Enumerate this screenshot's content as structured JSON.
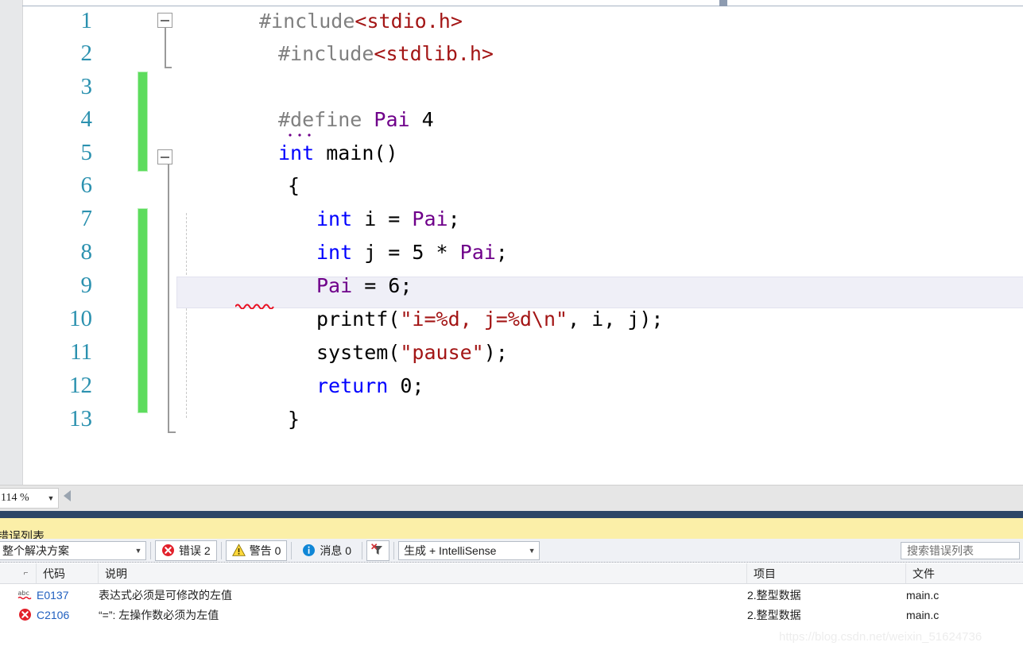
{
  "editor": {
    "zoom_level": "114 %",
    "lines": [
      {
        "num": "1",
        "text": "#include<stdio.h>"
      },
      {
        "num": "2",
        "text": "#include<stdlib.h>"
      },
      {
        "num": "3",
        "text": ""
      },
      {
        "num": "4",
        "text": "#define Pai 4"
      },
      {
        "num": "5",
        "text": "int main()"
      },
      {
        "num": "6",
        "text": "{"
      },
      {
        "num": "7",
        "text": "int i = Pai;"
      },
      {
        "num": "8",
        "text": "int j = 5 * Pai;"
      },
      {
        "num": "9",
        "text": "Pai = 6;"
      },
      {
        "num": "10",
        "text": "printf(\"i=%d, j=%d\\n\", i, j);"
      },
      {
        "num": "11",
        "text": "system(\"pause\");"
      },
      {
        "num": "12",
        "text": "return 0;"
      },
      {
        "num": "13",
        "text": "}"
      }
    ],
    "tokens": {
      "l1_pp": "#include",
      "l1_hdr": "<stdio.h>",
      "l2_pp": "#include",
      "l2_hdr": "<stdlib.h>",
      "l4_pp": "#define ",
      "l4_macro": "Pai",
      "l4_val": " 4",
      "l5_kw": "int",
      "l5_name": " main()",
      "l6": "{",
      "l7_kw": "int",
      "l7_mid": " i = ",
      "l7_macro": "Pai",
      "l7_end": ";",
      "l8_kw": "int",
      "l8_mid": " j = ",
      "l8_num": "5",
      "l8_op": " * ",
      "l8_macro": "Pai",
      "l8_end": ";",
      "l9_macro": "Pai",
      "l9_rest": " = 6;",
      "l10_fn": "printf(",
      "l10_str": "\"i=%d, j=%d\\n\"",
      "l10_args": ", i, j);",
      "l11_fn": "system(",
      "l11_str": "\"pause\"",
      "l11_end": ");",
      "l12_kw": "return",
      "l12_rest": " 0;",
      "l13": "}"
    }
  },
  "error_list": {
    "title": "错误列表",
    "scope_filter": "整个解决方案",
    "errors_label": "错误 2",
    "warnings_label": "警告 0",
    "messages_label": "消息 0",
    "build_filter": "生成 + IntelliSense",
    "search_placeholder": "搜索错误列表",
    "columns": [
      "",
      "代码",
      "说明",
      "项目",
      "文件"
    ],
    "rows": [
      {
        "icon": "intellisense-abc-icon",
        "code": "E0137",
        "description": "表达式必须是可修改的左值",
        "project": "2.整型数据",
        "file": "main.c"
      },
      {
        "icon": "error-circle-icon",
        "code": "C2106",
        "description": "“=”: 左操作数必须为左值",
        "project": "2.整型数据",
        "file": "main.c"
      }
    ]
  },
  "watermark": "https://blog.csdn.net/weixin_51624736"
}
